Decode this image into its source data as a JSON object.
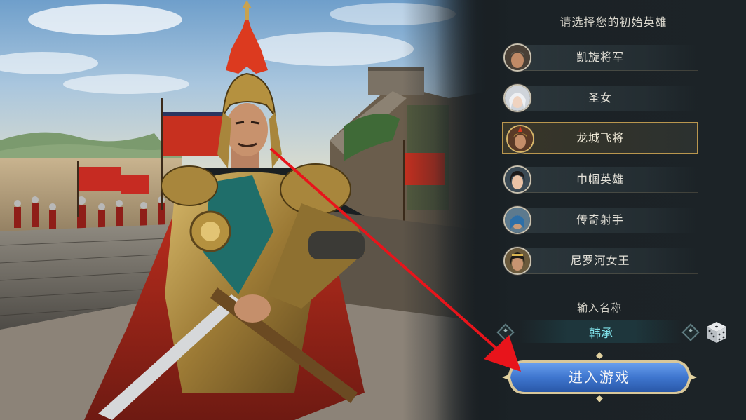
{
  "panel": {
    "title": "请选择您的初始英雄"
  },
  "heroes": [
    {
      "name": "凯旋将军",
      "selected": false,
      "avatar": "general-portrait-icon"
    },
    {
      "name": "圣女",
      "selected": false,
      "avatar": "saintess-portrait-icon"
    },
    {
      "name": "龙城飞将",
      "selected": true,
      "avatar": "flying-general-portrait-icon"
    },
    {
      "name": "巾帼英雄",
      "selected": false,
      "avatar": "heroine-portrait-icon"
    },
    {
      "name": "传奇射手",
      "selected": false,
      "avatar": "archer-portrait-icon"
    },
    {
      "name": "尼罗河女王",
      "selected": false,
      "avatar": "nile-queen-portrait-icon"
    }
  ],
  "name_entry": {
    "label": "输入名称",
    "value": "韩承"
  },
  "enter_button": {
    "label": "进入游戏"
  },
  "colors": {
    "selected_border": "#b9964e",
    "name_text": "#7fe0e8",
    "button_blue": "#3f76cf",
    "arrow_red": "#e8141b"
  },
  "icons": {
    "dice": "dice-icon",
    "diamond": "diamond-ornament-icon",
    "arrow": "red-pointer-arrow"
  }
}
